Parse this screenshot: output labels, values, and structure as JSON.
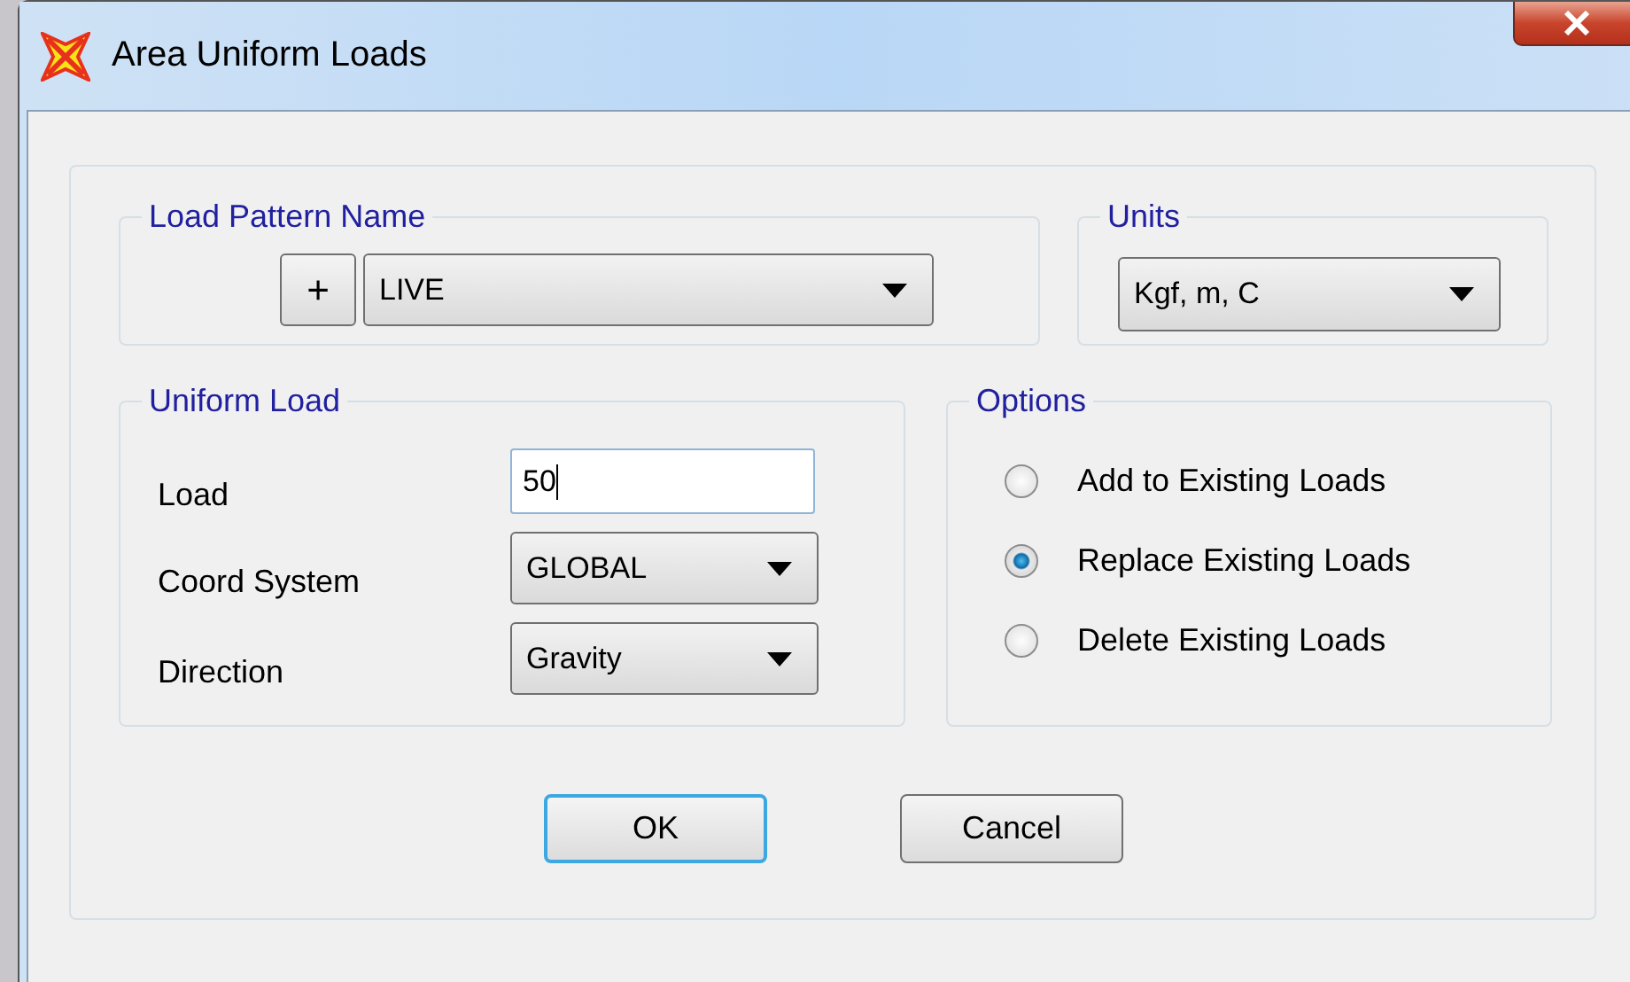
{
  "window": {
    "title": "Area Uniform Loads"
  },
  "load_pattern": {
    "legend": "Load Pattern Name",
    "add_button": "+",
    "value": "LIVE"
  },
  "units": {
    "legend": "Units",
    "value": "Kgf, m, C"
  },
  "uniform_load": {
    "legend": "Uniform Load",
    "fields": [
      {
        "kind": "text",
        "label": "Load",
        "value": "50"
      },
      {
        "kind": "combo",
        "label": "Coord System",
        "value": "GLOBAL"
      },
      {
        "kind": "combo",
        "label": "Direction",
        "value": "Gravity"
      }
    ]
  },
  "options": {
    "legend": "Options",
    "items": [
      {
        "label": "Add to Existing Loads",
        "selected": false
      },
      {
        "label": "Replace Existing Loads",
        "selected": true
      },
      {
        "label": "Delete Existing Loads",
        "selected": false
      }
    ]
  },
  "buttons": [
    {
      "label": "OK",
      "default": true
    },
    {
      "label": "Cancel",
      "default": false
    }
  ]
}
